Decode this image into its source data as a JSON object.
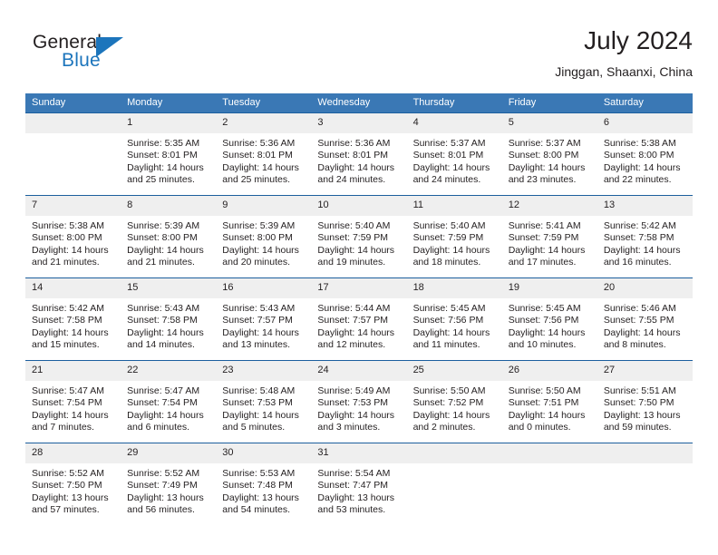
{
  "brand": {
    "name_top": "General",
    "name_bottom": "Blue",
    "triangle_color": "#1c75bc"
  },
  "header": {
    "title": "July 2024",
    "subtitle": "Jinggan, Shaanxi, China"
  },
  "theme": {
    "header_bar": "#3a78b5",
    "row_divider": "#1c5f9e",
    "daynum_bg": "#efefef",
    "text": "#231f20"
  },
  "weekdays": [
    "Sunday",
    "Monday",
    "Tuesday",
    "Wednesday",
    "Thursday",
    "Friday",
    "Saturday"
  ],
  "weeks": [
    [
      {
        "day": "",
        "sunrise": "",
        "sunset": "",
        "daylight_1": "",
        "daylight_2": ""
      },
      {
        "day": "1",
        "sunrise": "Sunrise: 5:35 AM",
        "sunset": "Sunset: 8:01 PM",
        "daylight_1": "Daylight: 14 hours",
        "daylight_2": "and 25 minutes."
      },
      {
        "day": "2",
        "sunrise": "Sunrise: 5:36 AM",
        "sunset": "Sunset: 8:01 PM",
        "daylight_1": "Daylight: 14 hours",
        "daylight_2": "and 25 minutes."
      },
      {
        "day": "3",
        "sunrise": "Sunrise: 5:36 AM",
        "sunset": "Sunset: 8:01 PM",
        "daylight_1": "Daylight: 14 hours",
        "daylight_2": "and 24 minutes."
      },
      {
        "day": "4",
        "sunrise": "Sunrise: 5:37 AM",
        "sunset": "Sunset: 8:01 PM",
        "daylight_1": "Daylight: 14 hours",
        "daylight_2": "and 24 minutes."
      },
      {
        "day": "5",
        "sunrise": "Sunrise: 5:37 AM",
        "sunset": "Sunset: 8:00 PM",
        "daylight_1": "Daylight: 14 hours",
        "daylight_2": "and 23 minutes."
      },
      {
        "day": "6",
        "sunrise": "Sunrise: 5:38 AM",
        "sunset": "Sunset: 8:00 PM",
        "daylight_1": "Daylight: 14 hours",
        "daylight_2": "and 22 minutes."
      }
    ],
    [
      {
        "day": "7",
        "sunrise": "Sunrise: 5:38 AM",
        "sunset": "Sunset: 8:00 PM",
        "daylight_1": "Daylight: 14 hours",
        "daylight_2": "and 21 minutes."
      },
      {
        "day": "8",
        "sunrise": "Sunrise: 5:39 AM",
        "sunset": "Sunset: 8:00 PM",
        "daylight_1": "Daylight: 14 hours",
        "daylight_2": "and 21 minutes."
      },
      {
        "day": "9",
        "sunrise": "Sunrise: 5:39 AM",
        "sunset": "Sunset: 8:00 PM",
        "daylight_1": "Daylight: 14 hours",
        "daylight_2": "and 20 minutes."
      },
      {
        "day": "10",
        "sunrise": "Sunrise: 5:40 AM",
        "sunset": "Sunset: 7:59 PM",
        "daylight_1": "Daylight: 14 hours",
        "daylight_2": "and 19 minutes."
      },
      {
        "day": "11",
        "sunrise": "Sunrise: 5:40 AM",
        "sunset": "Sunset: 7:59 PM",
        "daylight_1": "Daylight: 14 hours",
        "daylight_2": "and 18 minutes."
      },
      {
        "day": "12",
        "sunrise": "Sunrise: 5:41 AM",
        "sunset": "Sunset: 7:59 PM",
        "daylight_1": "Daylight: 14 hours",
        "daylight_2": "and 17 minutes."
      },
      {
        "day": "13",
        "sunrise": "Sunrise: 5:42 AM",
        "sunset": "Sunset: 7:58 PM",
        "daylight_1": "Daylight: 14 hours",
        "daylight_2": "and 16 minutes."
      }
    ],
    [
      {
        "day": "14",
        "sunrise": "Sunrise: 5:42 AM",
        "sunset": "Sunset: 7:58 PM",
        "daylight_1": "Daylight: 14 hours",
        "daylight_2": "and 15 minutes."
      },
      {
        "day": "15",
        "sunrise": "Sunrise: 5:43 AM",
        "sunset": "Sunset: 7:58 PM",
        "daylight_1": "Daylight: 14 hours",
        "daylight_2": "and 14 minutes."
      },
      {
        "day": "16",
        "sunrise": "Sunrise: 5:43 AM",
        "sunset": "Sunset: 7:57 PM",
        "daylight_1": "Daylight: 14 hours",
        "daylight_2": "and 13 minutes."
      },
      {
        "day": "17",
        "sunrise": "Sunrise: 5:44 AM",
        "sunset": "Sunset: 7:57 PM",
        "daylight_1": "Daylight: 14 hours",
        "daylight_2": "and 12 minutes."
      },
      {
        "day": "18",
        "sunrise": "Sunrise: 5:45 AM",
        "sunset": "Sunset: 7:56 PM",
        "daylight_1": "Daylight: 14 hours",
        "daylight_2": "and 11 minutes."
      },
      {
        "day": "19",
        "sunrise": "Sunrise: 5:45 AM",
        "sunset": "Sunset: 7:56 PM",
        "daylight_1": "Daylight: 14 hours",
        "daylight_2": "and 10 minutes."
      },
      {
        "day": "20",
        "sunrise": "Sunrise: 5:46 AM",
        "sunset": "Sunset: 7:55 PM",
        "daylight_1": "Daylight: 14 hours",
        "daylight_2": "and 8 minutes."
      }
    ],
    [
      {
        "day": "21",
        "sunrise": "Sunrise: 5:47 AM",
        "sunset": "Sunset: 7:54 PM",
        "daylight_1": "Daylight: 14 hours",
        "daylight_2": "and 7 minutes."
      },
      {
        "day": "22",
        "sunrise": "Sunrise: 5:47 AM",
        "sunset": "Sunset: 7:54 PM",
        "daylight_1": "Daylight: 14 hours",
        "daylight_2": "and 6 minutes."
      },
      {
        "day": "23",
        "sunrise": "Sunrise: 5:48 AM",
        "sunset": "Sunset: 7:53 PM",
        "daylight_1": "Daylight: 14 hours",
        "daylight_2": "and 5 minutes."
      },
      {
        "day": "24",
        "sunrise": "Sunrise: 5:49 AM",
        "sunset": "Sunset: 7:53 PM",
        "daylight_1": "Daylight: 14 hours",
        "daylight_2": "and 3 minutes."
      },
      {
        "day": "25",
        "sunrise": "Sunrise: 5:50 AM",
        "sunset": "Sunset: 7:52 PM",
        "daylight_1": "Daylight: 14 hours",
        "daylight_2": "and 2 minutes."
      },
      {
        "day": "26",
        "sunrise": "Sunrise: 5:50 AM",
        "sunset": "Sunset: 7:51 PM",
        "daylight_1": "Daylight: 14 hours",
        "daylight_2": "and 0 minutes."
      },
      {
        "day": "27",
        "sunrise": "Sunrise: 5:51 AM",
        "sunset": "Sunset: 7:50 PM",
        "daylight_1": "Daylight: 13 hours",
        "daylight_2": "and 59 minutes."
      }
    ],
    [
      {
        "day": "28",
        "sunrise": "Sunrise: 5:52 AM",
        "sunset": "Sunset: 7:50 PM",
        "daylight_1": "Daylight: 13 hours",
        "daylight_2": "and 57 minutes."
      },
      {
        "day": "29",
        "sunrise": "Sunrise: 5:52 AM",
        "sunset": "Sunset: 7:49 PM",
        "daylight_1": "Daylight: 13 hours",
        "daylight_2": "and 56 minutes."
      },
      {
        "day": "30",
        "sunrise": "Sunrise: 5:53 AM",
        "sunset": "Sunset: 7:48 PM",
        "daylight_1": "Daylight: 13 hours",
        "daylight_2": "and 54 minutes."
      },
      {
        "day": "31",
        "sunrise": "Sunrise: 5:54 AM",
        "sunset": "Sunset: 7:47 PM",
        "daylight_1": "Daylight: 13 hours",
        "daylight_2": "and 53 minutes."
      },
      {
        "day": "",
        "sunrise": "",
        "sunset": "",
        "daylight_1": "",
        "daylight_2": ""
      },
      {
        "day": "",
        "sunrise": "",
        "sunset": "",
        "daylight_1": "",
        "daylight_2": ""
      },
      {
        "day": "",
        "sunrise": "",
        "sunset": "",
        "daylight_1": "",
        "daylight_2": ""
      }
    ]
  ]
}
